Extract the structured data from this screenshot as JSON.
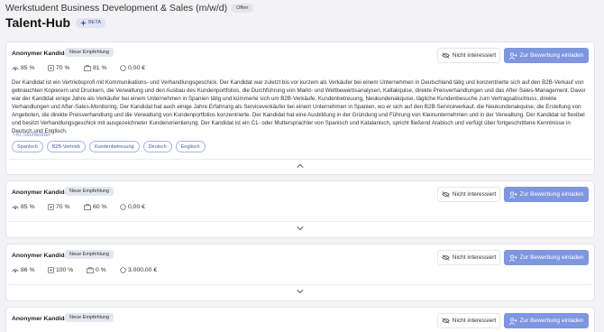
{
  "header": {
    "job_title": "Werkstudent Business Development & Sales (m/w/d)",
    "status_badge": "Offen",
    "hub_title": "Talent-Hub",
    "beta_label": "BETA"
  },
  "actions": {
    "not_interested": "Nicht interessiert",
    "invite": "Zur Bewerbung einladen",
    "anonymous_label": "Anonymer Kandidat",
    "recommendation_badge": "Neue Empfehlung"
  },
  "colors": {
    "primary": "#7f96e0",
    "tag_border": "#a7b2e6",
    "keyword_label": "#7b86c7"
  },
  "candidates": [
    {
      "match": "85 %",
      "skills": "70 %",
      "experience": "81 %",
      "salary": "0,00 €",
      "expanded": true,
      "description": "Der Kandidat ist ein Vertriebsprofi mit Kommunikations- und Verhandlungsgeschick. Der Kandidat war zuletzt bis vor kurzem als Verkäufer bei einem Unternehmen in Deutschland tätig und konzentrierte sich auf den B2B-Verkauf von gebrauchten Kopierern und Druckern, die Verwaltung und den Ausbau des Kundenportfolios, die Durchführung von Markt- und Wettbewerbsanalysen, Kaltakquise, direkte Preisverhandlungen und das After-Sales-Management. Davor war der Kandidat einige Jahre als Verkäufer bei einem Unternehmen in Spanien tätig und kümmerte sich um B2B-Verkäufe, Kundenbetreuung, Neukundenakquise, tägliche Kundenbesuche zum Vertragsabschluss, direkte Verhandlungen und After-Sales-Monitoring. Der Kandidat hat auch einige Jahre Erfahrung als Serviceverkäufer bei einem Unternehmen in Spanien, wo er sich auf den B2B-Serviceverkauf, die Neukundenakquise, die Erstellung von Angeboten, die direkte Preisverhandlung und die Verwaltung von Kundenportfolios konzentrierte. Der Kandidat hat eine Ausbildung in der Gründung und Führung von Kleinunternehmen und in der Verwaltung. Der Kandidat ist flexibel und besitzt Verhandlungsgeschick mit ausgezeichneter Kundenorientierung. Der Kandidat ist ein C1- oder Muttersprachler von Spanisch und Katalanisch, spricht fließend Arabisch und verfügt über fortgeschrittene Kenntnisse in Deutsch und Englisch.",
      "keywords_label": "KI-Stichwörter",
      "keywords": [
        "Spanisch",
        "B2B-Vertrieb",
        "Kundenbetreuung",
        "Deutsch",
        "Englisch"
      ]
    },
    {
      "match": "85 %",
      "skills": "70 %",
      "experience": "60 %",
      "salary": "0,00 €",
      "expanded": false
    },
    {
      "match": "86 %",
      "skills": "100 %",
      "experience": "0 %",
      "salary": "3.000,00 €",
      "expanded": false
    },
    {
      "match": "",
      "skills": "",
      "experience": "",
      "salary": "",
      "expanded": false
    }
  ]
}
